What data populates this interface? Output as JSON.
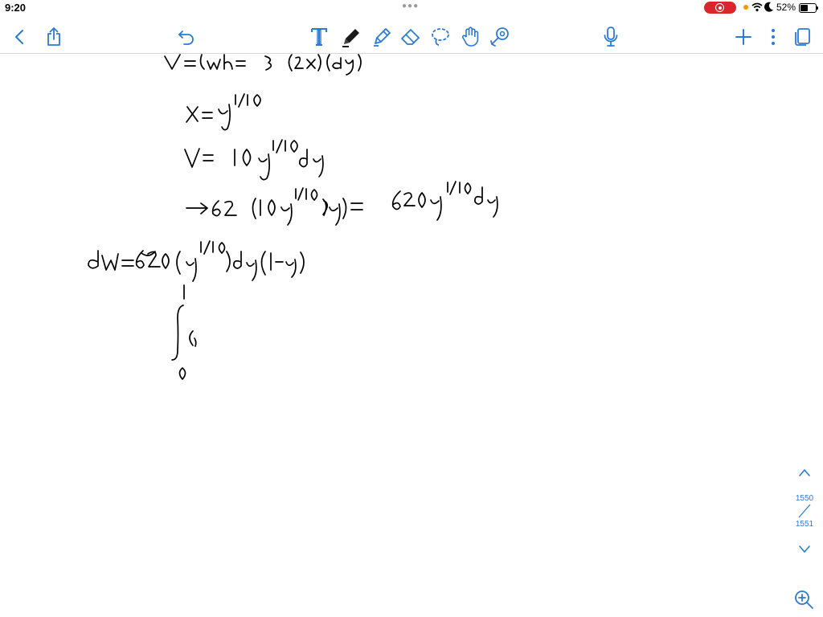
{
  "status_bar": {
    "time": "9:20",
    "battery_percent": "52%",
    "battery_level": 0.52
  },
  "toolbar": {
    "icons": [
      "back-icon",
      "share-icon",
      "undo-icon",
      "text-tool-icon",
      "pen-icon",
      "highlighter-icon",
      "eraser-icon",
      "lasso-icon",
      "hand-tool-icon",
      "shape-tool-icon",
      "microphone-icon",
      "add-icon",
      "more-icon",
      "pages-icon"
    ]
  },
  "pager": {
    "current_page": "1550",
    "total_pages": "1551"
  },
  "accent_color": "#2a7bd3",
  "handwriting": {
    "line_1": "V = lwh = ? (2x)(dy)",
    "line_2": "x = y^1/10",
    "line_3": "V = 10 y^1/10 dy",
    "line_4": "→ 62 (10y^1/10 dy) = 620y^1/10 dy",
    "line_5": "dW = 620 (y^1/10) dy (1 − y)",
    "line_6": "∫₀¹ ("
  }
}
